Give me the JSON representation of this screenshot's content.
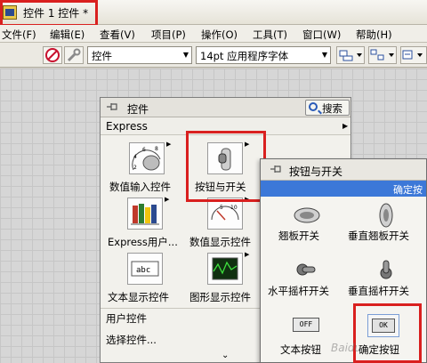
{
  "window": {
    "title": "控件 1 控件 *"
  },
  "menu": [
    "文件(F)",
    "编辑(E)",
    "查看(V)",
    "项目(P)",
    "操作(O)",
    "工具(T)",
    "窗口(W)",
    "帮助(H)"
  ],
  "toolbar": {
    "category_select": "控件",
    "font_select": "14pt 应用程序字体"
  },
  "palette": {
    "title": "控件",
    "search_label": "搜索",
    "section": "Express",
    "tiles": [
      {
        "label": "数值输入控件"
      },
      {
        "label": "按钮与开关"
      },
      {
        "label": "Express用户..."
      },
      {
        "label": "数值显示控件"
      },
      {
        "label": "文本显示控件"
      },
      {
        "label": "图形显示控件"
      }
    ],
    "list": [
      "用户控件",
      "选择控件..."
    ],
    "scroll_glyph": "⌄"
  },
  "subpalette": {
    "title": "按钮与开关",
    "strip_text": "确定按",
    "items": [
      {
        "label": "翘板开关"
      },
      {
        "label": "垂直翘板开关"
      },
      {
        "label": "水平摇杆开关"
      },
      {
        "label": "垂直摇杆开关"
      },
      {
        "label": "文本按钮"
      },
      {
        "label": "确定按钮"
      }
    ],
    "off_text": "OFF",
    "ok_text": "OK"
  },
  "icons": {
    "numeric_scale": [
      "2",
      "4",
      "6",
      "8"
    ],
    "numeric_display_scale": [
      "5",
      "10"
    ],
    "text_display": "abc"
  },
  "watermark": "Baidu"
}
